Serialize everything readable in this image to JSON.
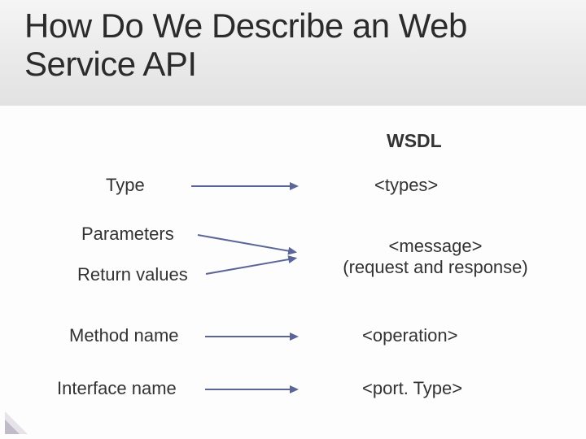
{
  "title": "How Do We Describe an Web Service API",
  "header_right": "WSDL",
  "rows": {
    "type": {
      "left": "Type",
      "right": "<types>"
    },
    "parameters": {
      "left": "Parameters"
    },
    "return": {
      "left": "Return values"
    },
    "message": {
      "right_line1": "<message>",
      "right_line2": "(request and response)"
    },
    "method": {
      "left": "Method name",
      "right": "<operation>"
    },
    "interface": {
      "left": "Interface name",
      "right": "<port. Type>"
    }
  }
}
